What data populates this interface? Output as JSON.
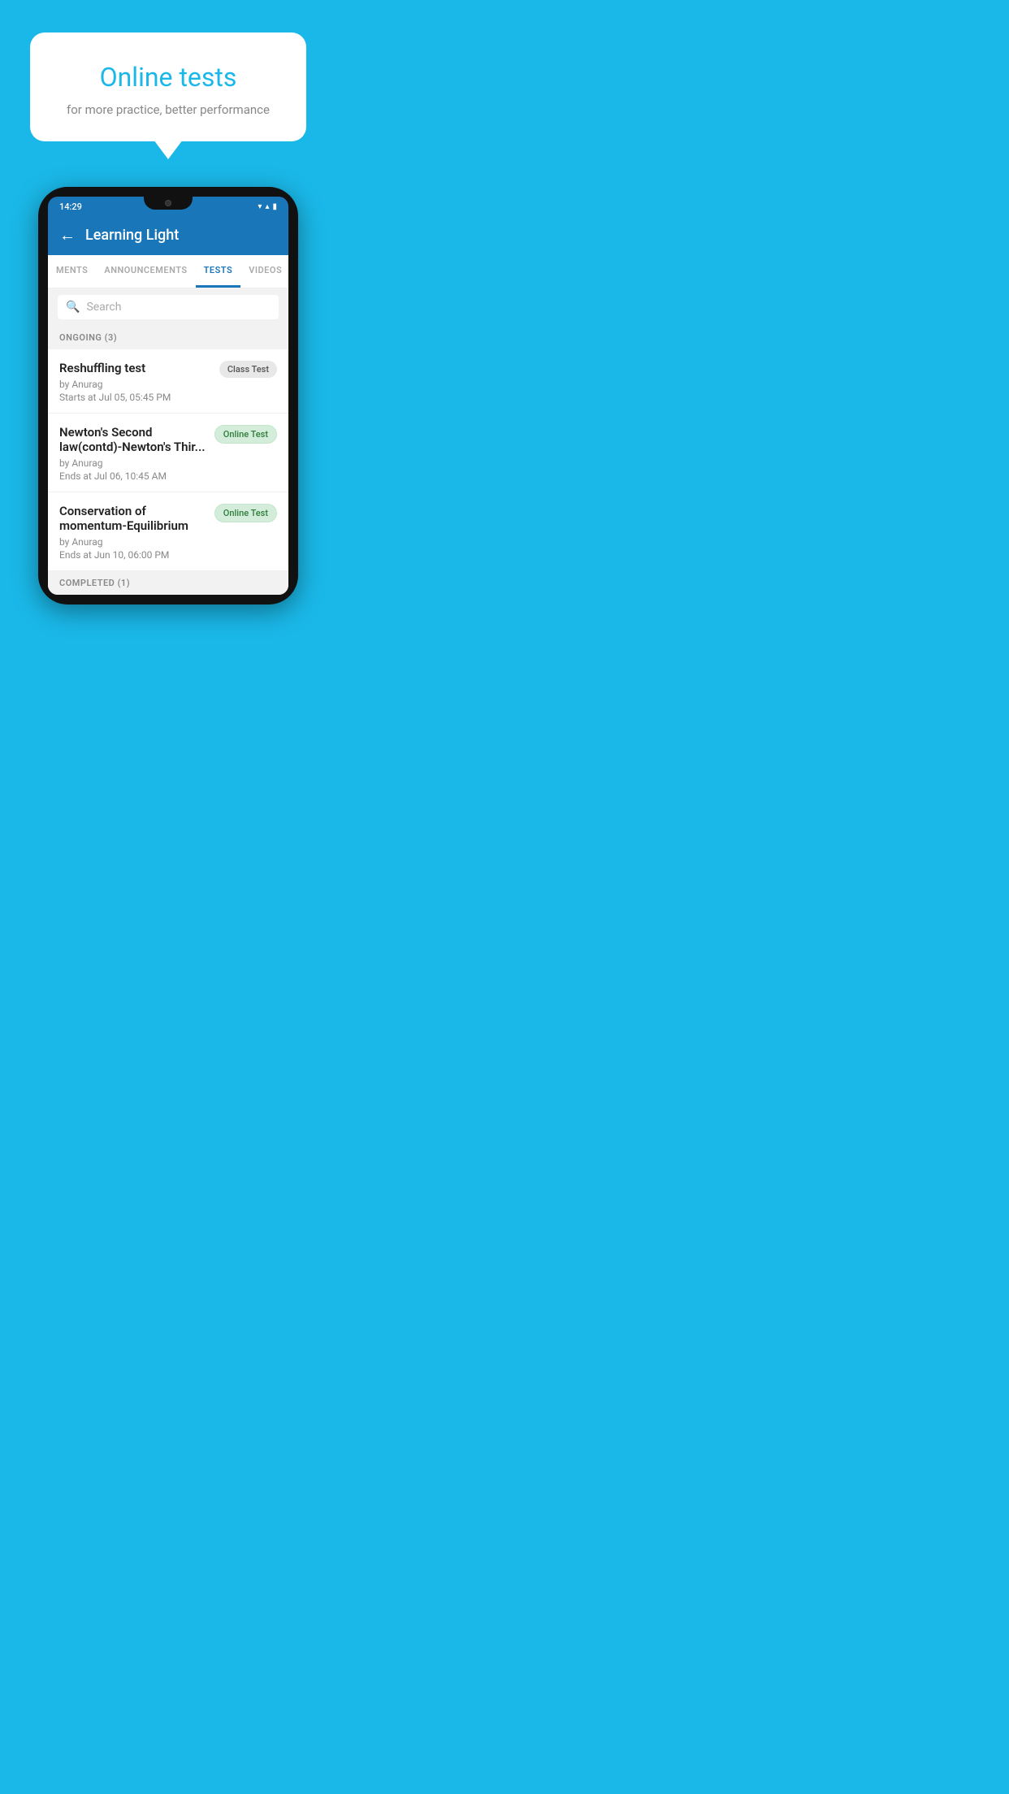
{
  "background_color": "#1ab8e8",
  "speech_bubble": {
    "title": "Online tests",
    "subtitle": "for more practice, better performance"
  },
  "status_bar": {
    "time": "14:29",
    "icons": [
      "▼",
      "▲",
      "▮"
    ]
  },
  "app_header": {
    "back_label": "←",
    "title": "Learning Light"
  },
  "tabs": [
    {
      "label": "MENTS",
      "active": false
    },
    {
      "label": "ANNOUNCEMENTS",
      "active": false
    },
    {
      "label": "TESTS",
      "active": true
    },
    {
      "label": "VIDEOS",
      "active": false
    }
  ],
  "search": {
    "placeholder": "Search"
  },
  "ongoing_section": {
    "header": "ONGOING (3)",
    "items": [
      {
        "name": "Reshuffling test",
        "by": "by Anurag",
        "date": "Starts at  Jul 05, 05:45 PM",
        "badge": "Class Test",
        "badge_type": "class"
      },
      {
        "name": "Newton's Second law(contd)-Newton's Thir...",
        "by": "by Anurag",
        "date": "Ends at  Jul 06, 10:45 AM",
        "badge": "Online Test",
        "badge_type": "online"
      },
      {
        "name": "Conservation of momentum-Equilibrium",
        "by": "by Anurag",
        "date": "Ends at  Jun 10, 06:00 PM",
        "badge": "Online Test",
        "badge_type": "online"
      }
    ]
  },
  "completed_section": {
    "header": "COMPLETED (1)"
  }
}
